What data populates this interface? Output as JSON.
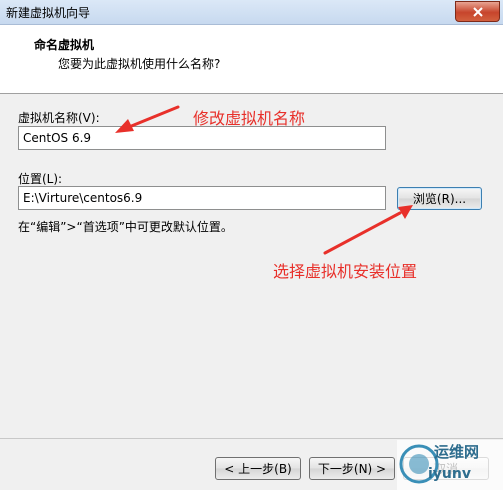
{
  "window": {
    "title": "新建虚拟机向导"
  },
  "header": {
    "title": "命名虚拟机",
    "subtitle": "您要为此虚拟机使用什么名称?"
  },
  "form": {
    "name_label": "虚拟机名称(V):",
    "name_value": "CentOS 6.9",
    "location_label": "位置(L):",
    "location_value": "E:\\Virture\\centos6.9",
    "browse_label": "浏览(R)...",
    "hint": "在“编辑”>“首选项”中可更改默认位置。"
  },
  "annotations": {
    "rename": "修改虚拟机名称",
    "choose_location": "选择虚拟机安装位置",
    "color": "#e8302a"
  },
  "footer": {
    "back_label": "< 上一步(B)",
    "next_label": "下一步(N) >",
    "cancel_label": "取消"
  },
  "watermark": {
    "line1": "运维网",
    "line2": "iyunv"
  }
}
